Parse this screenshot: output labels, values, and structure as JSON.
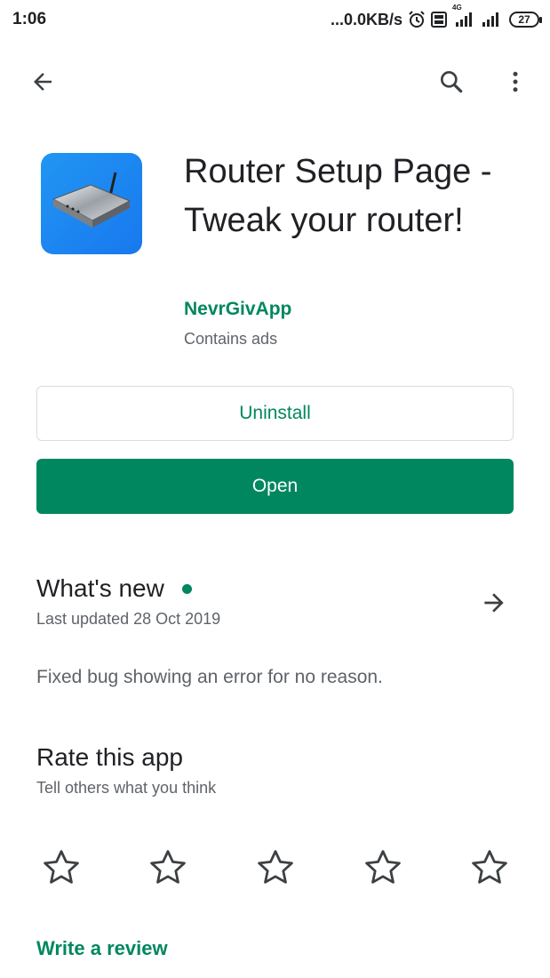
{
  "status_bar": {
    "time": "1:06",
    "network_speed": "...0.0KB/s",
    "icons": [
      "alarm-icon",
      "volte-icon",
      "signal-4g-icon",
      "signal-icon"
    ],
    "network_type": "4G",
    "battery_level": "27"
  },
  "toolbar": {
    "back_icon": "arrow-left-icon",
    "search_icon": "search-icon",
    "more_icon": "more-vert-icon"
  },
  "app": {
    "icon": "router-icon",
    "title": "Router Setup Page - Tweak your router!",
    "developer": "NevrGivApp",
    "contains_ads": "Contains ads"
  },
  "actions": {
    "uninstall_label": "Uninstall",
    "open_label": "Open"
  },
  "whats_new": {
    "title": "What's new",
    "last_updated": "Last updated 28 Oct 2019",
    "body": "Fixed bug showing an error for no reason."
  },
  "rate": {
    "title": "Rate this app",
    "subtitle": "Tell others what you think",
    "stars": 5,
    "rating": 0,
    "write_review_label": "Write a review"
  },
  "colors": {
    "accent": "#01875f",
    "icon_bg": "#1878ee",
    "text_primary": "#202124",
    "text_secondary": "#5f6368"
  }
}
